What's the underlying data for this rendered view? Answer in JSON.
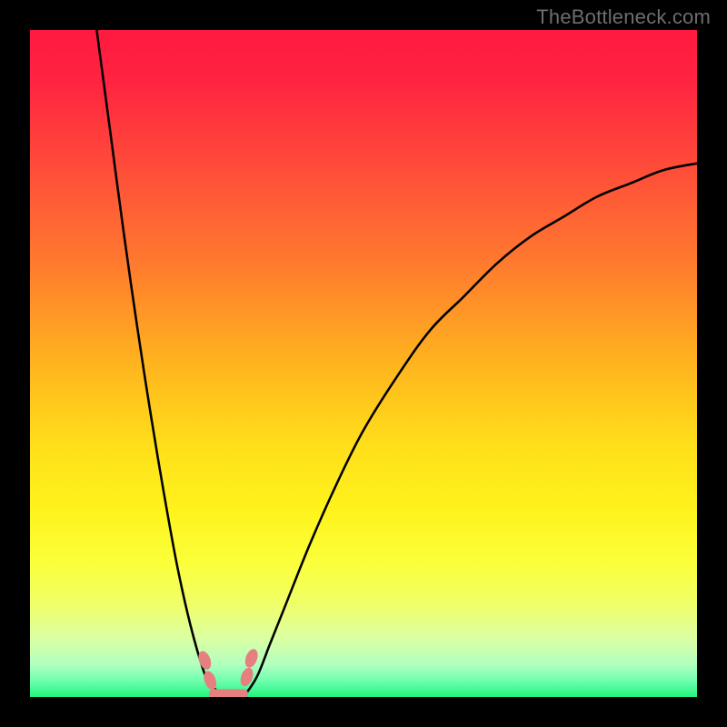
{
  "watermark": "TheBottleneck.com",
  "chart_data": {
    "type": "line",
    "title": "",
    "xlabel": "",
    "ylabel": "",
    "xlim": [
      0,
      100
    ],
    "ylim": [
      0,
      100
    ],
    "series": [
      {
        "name": "left-curve",
        "x": [
          10,
          12,
          14,
          16,
          18,
          20,
          22,
          24,
          26,
          27,
          28,
          29,
          30
        ],
        "y": [
          100,
          85,
          70,
          56,
          43,
          31,
          20,
          11,
          4,
          2,
          1,
          0.5,
          0
        ]
      },
      {
        "name": "right-curve",
        "x": [
          32,
          34,
          36,
          38,
          42,
          46,
          50,
          55,
          60,
          65,
          70,
          75,
          80,
          85,
          90,
          95,
          100
        ],
        "y": [
          0,
          3,
          8,
          13,
          23,
          32,
          40,
          48,
          55,
          60,
          65,
          69,
          72,
          75,
          77,
          79,
          80
        ]
      }
    ],
    "markers": [
      {
        "name": "marker-left-upper",
        "x": 26.2,
        "y": 5.5
      },
      {
        "name": "marker-left-lower",
        "x": 27.0,
        "y": 2.5
      },
      {
        "name": "marker-right-lower",
        "x": 32.5,
        "y": 3.0
      },
      {
        "name": "marker-right-upper",
        "x": 33.2,
        "y": 5.8
      }
    ],
    "base_segment": {
      "x0": 27.5,
      "x1": 32.0,
      "y": 0.5
    },
    "gradient_stops": [
      {
        "offset": 0.0,
        "color": "#ff193f"
      },
      {
        "offset": 0.08,
        "color": "#ff2540"
      },
      {
        "offset": 0.2,
        "color": "#ff4a3a"
      },
      {
        "offset": 0.35,
        "color": "#ff7a2e"
      },
      {
        "offset": 0.5,
        "color": "#ffb41e"
      },
      {
        "offset": 0.62,
        "color": "#ffde1a"
      },
      {
        "offset": 0.72,
        "color": "#fff31c"
      },
      {
        "offset": 0.8,
        "color": "#fbff3b"
      },
      {
        "offset": 0.86,
        "color": "#f0ff68"
      },
      {
        "offset": 0.91,
        "color": "#dcffa0"
      },
      {
        "offset": 0.95,
        "color": "#b4ffc0"
      },
      {
        "offset": 0.975,
        "color": "#70ffb0"
      },
      {
        "offset": 1.0,
        "color": "#22f57d"
      }
    ],
    "marker_color": "#e68080",
    "curve_color": "#000000"
  }
}
